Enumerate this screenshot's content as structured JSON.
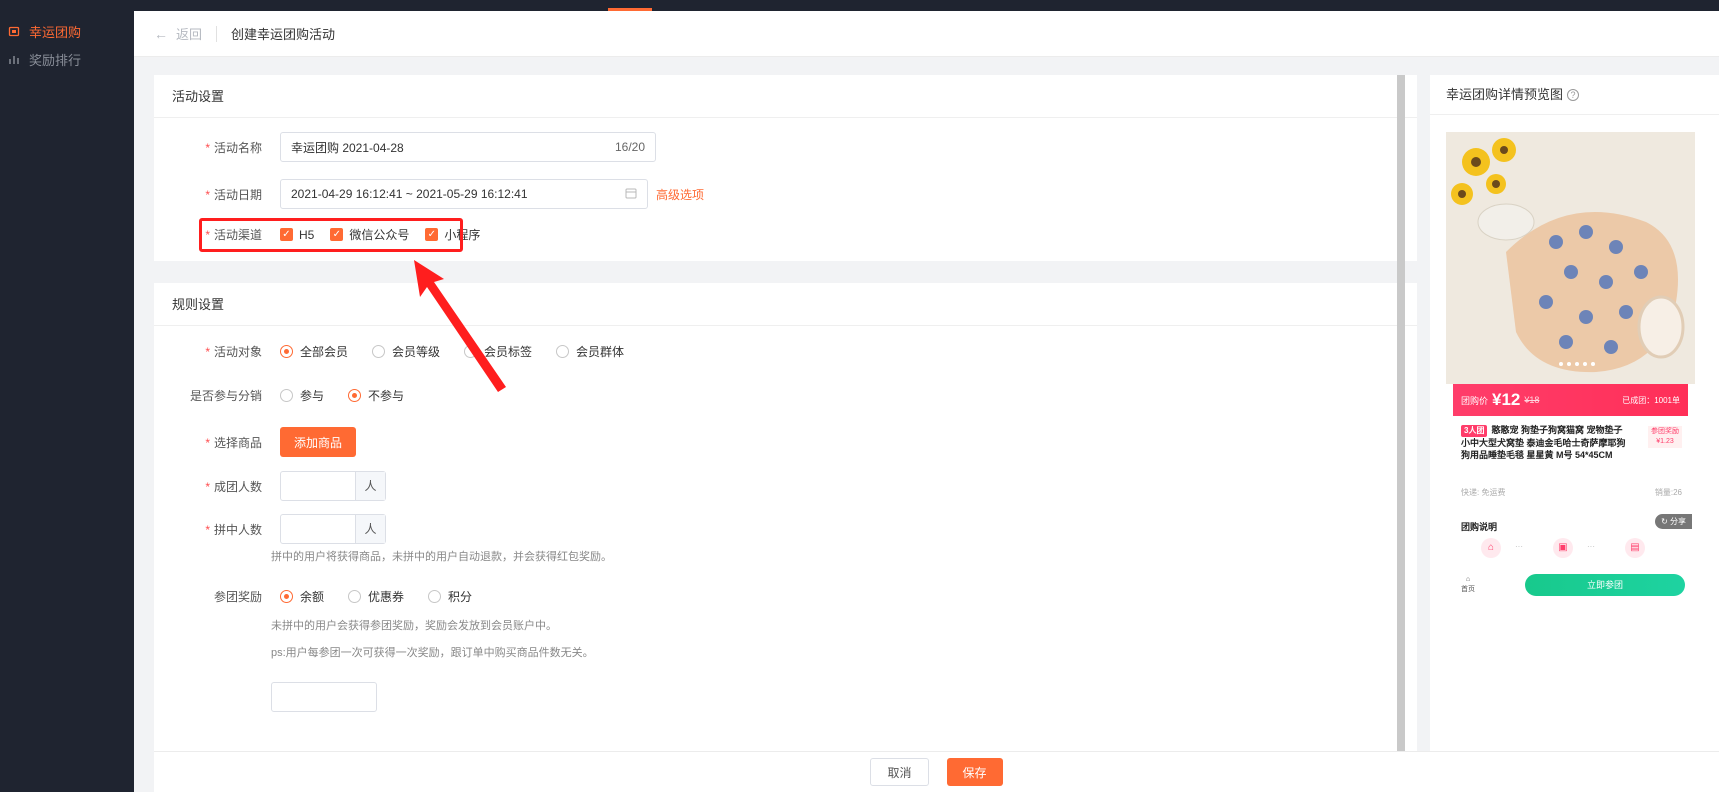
{
  "sidebar": {
    "items": [
      {
        "label": "幸运团购",
        "icon": "group-buy-icon",
        "active": true
      },
      {
        "label": "奖励排行",
        "icon": "bar-chart-icon",
        "active": false
      }
    ]
  },
  "header": {
    "back_label": "返回",
    "title": "创建幸运团购活动"
  },
  "activity_settings": {
    "title": "活动设置",
    "name_label": "活动名称",
    "name_value": "幸运团购  2021-04-28",
    "name_count": "16/20",
    "date_label": "活动日期",
    "date_value": "2021-04-29 16:12:41  ~  2021-05-29 16:12:41",
    "advanced_link": "高级选项",
    "channel_label": "活动渠道",
    "channels": [
      "H5",
      "微信公众号",
      "小程序"
    ]
  },
  "rule_settings": {
    "title": "规则设置",
    "target_label": "活动对象",
    "target_options": [
      "全部会员",
      "会员等级",
      "会员标签",
      "会员群体"
    ],
    "target_selected": "全部会员",
    "distribution_label": "是否参与分销",
    "distribution_options": [
      "参与",
      "不参与"
    ],
    "distribution_selected": "不参与",
    "product_label": "选择商品",
    "add_product_button": "添加商品",
    "group_size_label": "成团人数",
    "group_size_unit": "人",
    "winner_count_label": "拼中人数",
    "winner_count_unit": "人",
    "winner_hint": "拼中的用户将获得商品，未拼中的用户自动退款，并会获得红包奖励。",
    "reward_label": "参团奖励",
    "reward_options": [
      "余额",
      "优惠券",
      "积分"
    ],
    "reward_selected": "余额",
    "reward_hint_1": "未拼中的用户会获得参团奖励，奖励会发放到会员账户中。",
    "reward_hint_2": "ps:用户每参团一次可获得一次奖励，跟订单中购买商品件数无关。"
  },
  "footer": {
    "cancel_label": "取消",
    "save_label": "保存"
  },
  "preview": {
    "title": "幸运团购详情预览图",
    "price_prefix": "团购价",
    "price": "¥12",
    "original_price": "¥18",
    "joined": "已成团：1001单",
    "tag": "3人团",
    "product_name": "憨憨宠 狗垫子狗窝猫窝 宠物垫子小中大型犬窝垫 泰迪金毛哈士奇萨摩耶狗狗用品睡垫毛毯 星星黄 M号 54*45CM",
    "reward_label": "参团奖励",
    "reward_value": "¥1.23",
    "shipping": "快递: 免运费",
    "sold": "销量:26",
    "section_title": "团购说明",
    "share_label": "分享",
    "home_label": "首页",
    "join_button": "立即参团",
    "accent_color": "#ff3d6a",
    "join_color": "#18c98c"
  },
  "colors": {
    "primary": "#ff6a33",
    "sidebar_bg": "#1f2430",
    "highlight": "#ff1e1e"
  }
}
